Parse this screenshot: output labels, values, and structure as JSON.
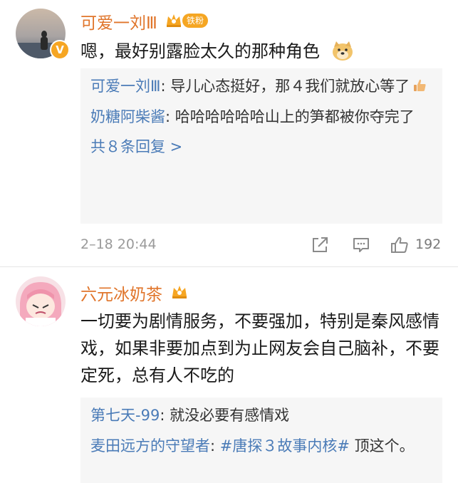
{
  "comments": [
    {
      "username": "可爱一刘Ⅲ",
      "fan_badge": "铁粉",
      "text": "嗯，最好别露脸太久的那种角色",
      "emoji_icon": "doge-emoji-icon",
      "replies": [
        {
          "author": "可爱一刘Ⅲ",
          "sep": ": ",
          "text": "导儿心态挺好，那４我们就放心等了",
          "emoji_icon": "thumbs-up-emoji-icon"
        },
        {
          "author": "奶糖阿柴酱",
          "sep": ": ",
          "text": "哈哈哈哈哈哈山上的笋都被你夺完了"
        }
      ],
      "more_replies": "共８条回复 >",
      "timestamp": "2–18 20:44",
      "like_count": "192"
    },
    {
      "username": "六元冰奶茶",
      "text": "一切要为剧情服务，不要强加，特别是秦风感情戏，如果非要加点到为止网友会自己脑补，不要定死，总有人不吃的",
      "replies": [
        {
          "author": "第七天-99",
          "sep": ": ",
          "text": "就没必要有感情戏"
        },
        {
          "author": "麦田远方的守望者",
          "sep": ": ",
          "tag": "#唐探３故事内核#",
          "text": " 顶这个。"
        }
      ]
    }
  ],
  "colors": {
    "username": "#e0752b",
    "link": "#4a7bb7",
    "reply_bg": "#f6f6f6",
    "meta_text": "#9a9a9a",
    "badge": "#f5a623"
  },
  "icons": {
    "share": "share-icon",
    "comment": "comment-icon",
    "like": "like-icon",
    "verified": "verified-v-icon",
    "crown": "crown-badge-icon"
  }
}
